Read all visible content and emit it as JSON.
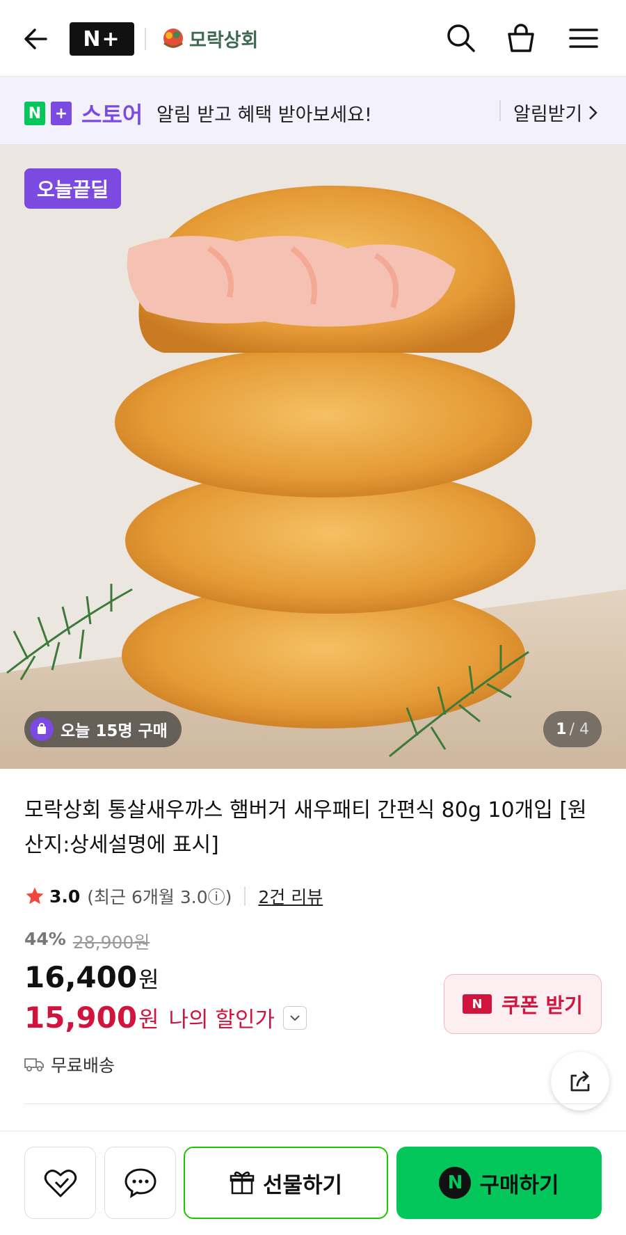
{
  "header": {
    "np_logo": "N+",
    "brand_name": "모락상회"
  },
  "banner": {
    "n_letter": "N",
    "plus_letter": "+",
    "store_label": "스토어",
    "message": "알림 받고 혜택 받아보세요!",
    "cta": "알림받기"
  },
  "image": {
    "deal_badge": "오늘끝딜",
    "buyers_today": "오늘 15명 구매",
    "page_current": "1",
    "page_total": "/ 4"
  },
  "product": {
    "title": "모락상회 통살새우까스 햄버거 새우패티 간편식 80g 10개입 [원산지:상세설명에 표시]",
    "rating": "3.0",
    "rating_sub": "(최근 6개월 3.0ⓘ)",
    "reviews": "2건 리뷰",
    "discount_pct": "44%",
    "original_price": "28,900원",
    "sale_price": "16,400",
    "my_price": "15,900",
    "currency": "원",
    "my_price_label": "나의 할인가",
    "coupon_icon": "N",
    "coupon_label": "쿠폰 받기",
    "shipping": "무료배송"
  },
  "bottom_bar": {
    "gift_label": "선물하기",
    "buy_icon": "N",
    "buy_label": "구매하기"
  },
  "colors": {
    "accent_purple": "#7b4ae0",
    "naver_green": "#03c75a",
    "price_red": "#d1143d"
  }
}
